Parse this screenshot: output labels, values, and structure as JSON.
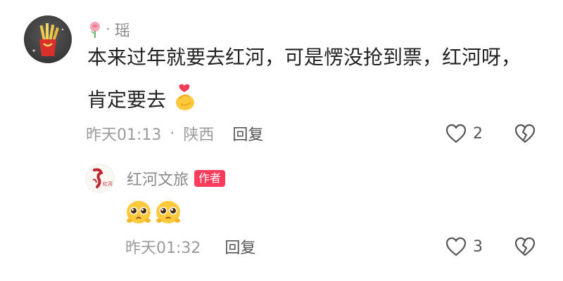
{
  "comment": {
    "username": "瑶",
    "name_separator": "·",
    "text_line1": "本来过年就要去红河，可是愣没抢到票，红河呀，",
    "text_line2": "肯定要去",
    "time": "昨天01:13",
    "meta_separator": "·",
    "location": "陕西",
    "reply_label": "回复",
    "like_count": "2"
  },
  "reply": {
    "username": "红河文旅",
    "badge": "作者",
    "time": "昨天01:32",
    "reply_label": "回复",
    "like_count": "3"
  },
  "colors": {
    "badge": "#ff3b5c",
    "meta_text": "#9a9a9a",
    "body_text": "#222222"
  },
  "icons": {
    "username_prefix": "rose-icon",
    "like": "heart-outline-icon",
    "dislike": "broken-heart-icon",
    "emoji_comment": "finger-heart-emoji",
    "emoji_reply": "pleading-face-emoji"
  }
}
